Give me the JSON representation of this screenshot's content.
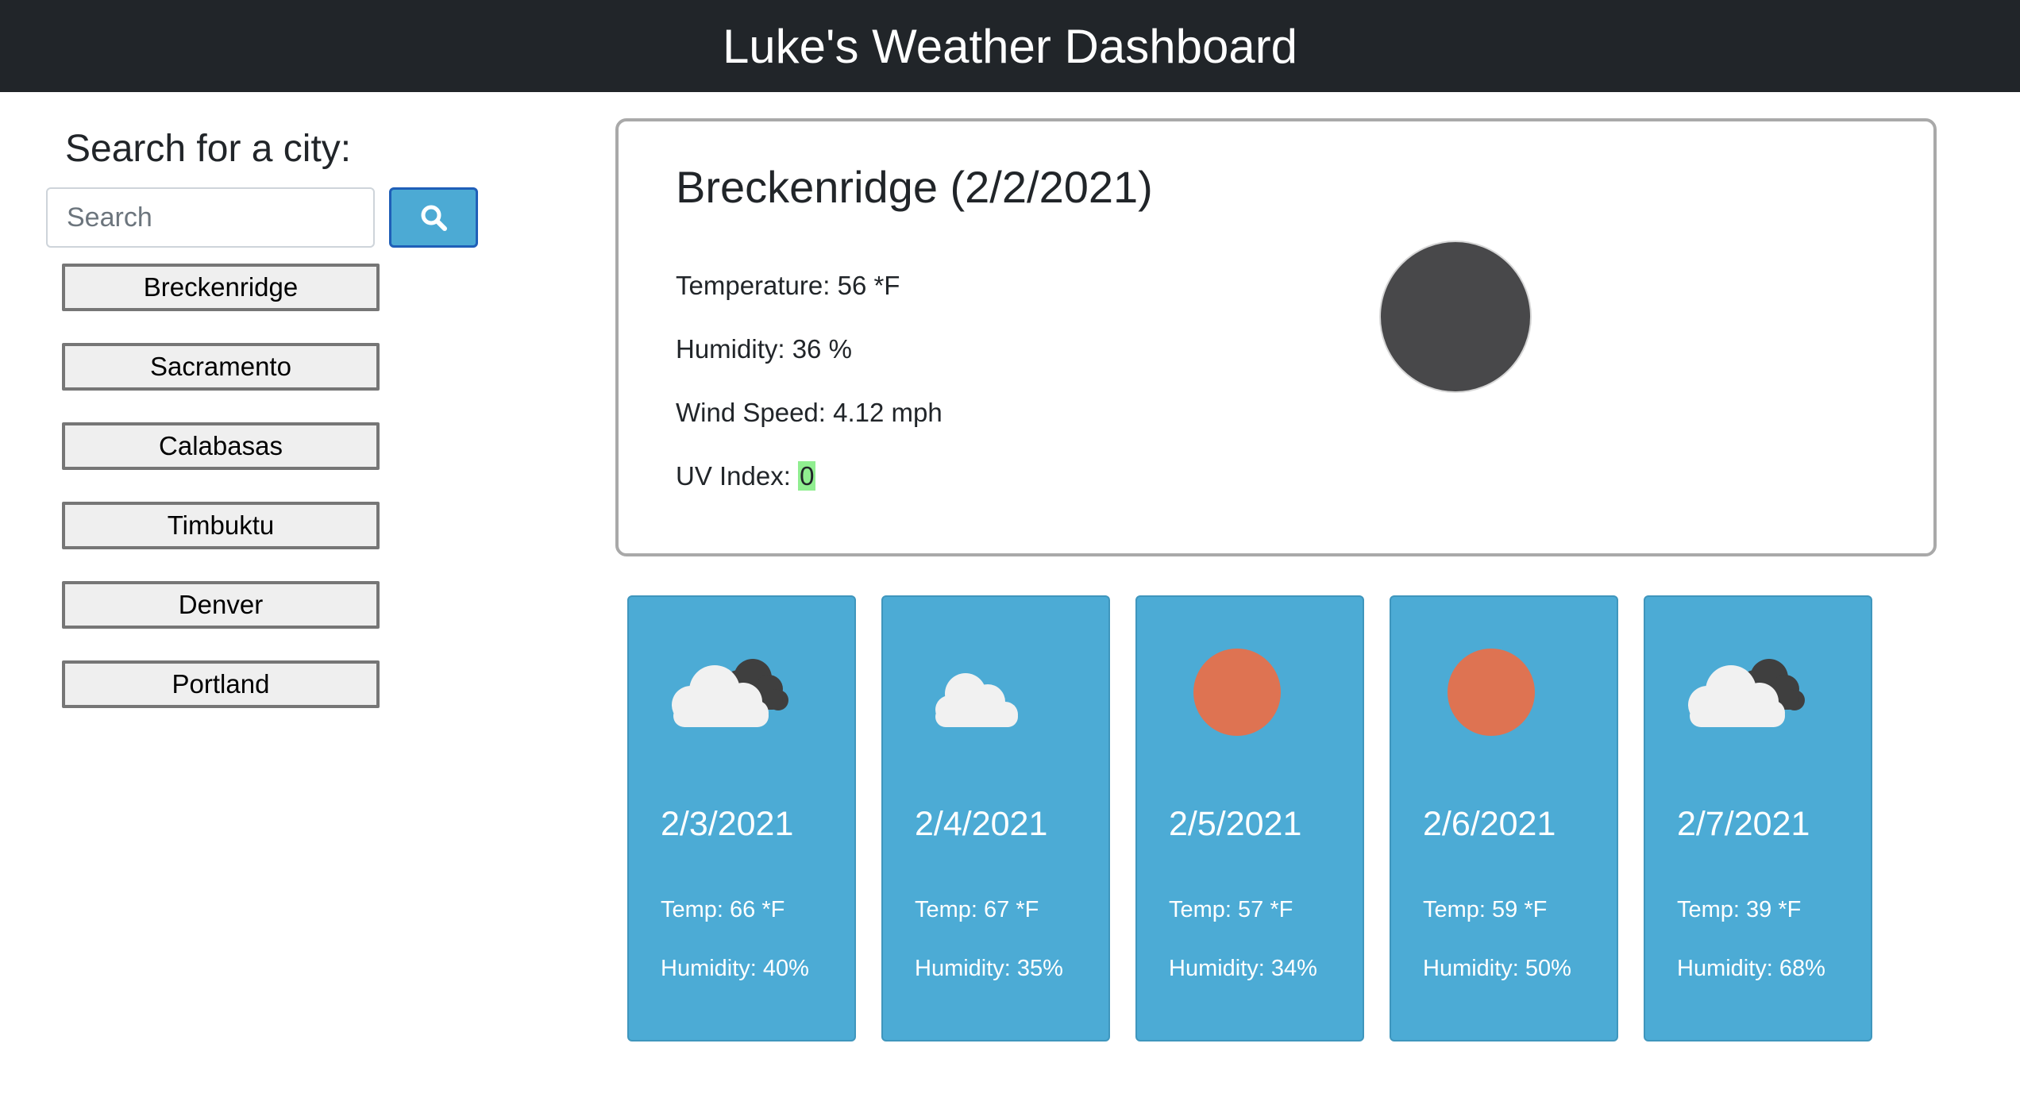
{
  "header": {
    "title": "Luke's Weather Dashboard"
  },
  "sidebar": {
    "heading": "Search for a city:",
    "search_placeholder": "Search",
    "search_value": "",
    "search_button_icon": "search-icon",
    "cities": [
      "Breckenridge",
      "Sacramento",
      "Calabasas",
      "Timbuktu",
      "Denver",
      "Portland"
    ]
  },
  "current": {
    "title": "Breckenridge (2/2/2021)",
    "temperature_label": "Temperature: 56 *F",
    "humidity_label": "Humidity: 36 %",
    "wind_label": "Wind Speed: 4.12 mph",
    "uv_label": "UV Index:",
    "uv_value": "0",
    "icon": "night-clear-icon"
  },
  "forecast": [
    {
      "date": "2/3/2021",
      "temp": "Temp: 66 *F",
      "humidity": "Humidity: 40%",
      "icon": "broken-clouds-icon"
    },
    {
      "date": "2/4/2021",
      "temp": "Temp: 67 *F",
      "humidity": "Humidity: 35%",
      "icon": "few-clouds-icon"
    },
    {
      "date": "2/5/2021",
      "temp": "Temp: 57 *F",
      "humidity": "Humidity: 34%",
      "icon": "clear-sky-icon"
    },
    {
      "date": "2/6/2021",
      "temp": "Temp: 59 *F",
      "humidity": "Humidity: 50%",
      "icon": "clear-sky-icon"
    },
    {
      "date": "2/7/2021",
      "temp": "Temp: 39 *F",
      "humidity": "Humidity: 68%",
      "icon": "broken-clouds-icon"
    }
  ],
  "colors": {
    "header_bg": "#212529",
    "card_blue": "#4cabd5",
    "search_button": "#4caad4",
    "uv_badge": "#90ee90",
    "sun": "#de7352",
    "moon": "#48484a",
    "cloud_light": "#f1f1f1",
    "cloud_dark": "#3f3f3f"
  }
}
